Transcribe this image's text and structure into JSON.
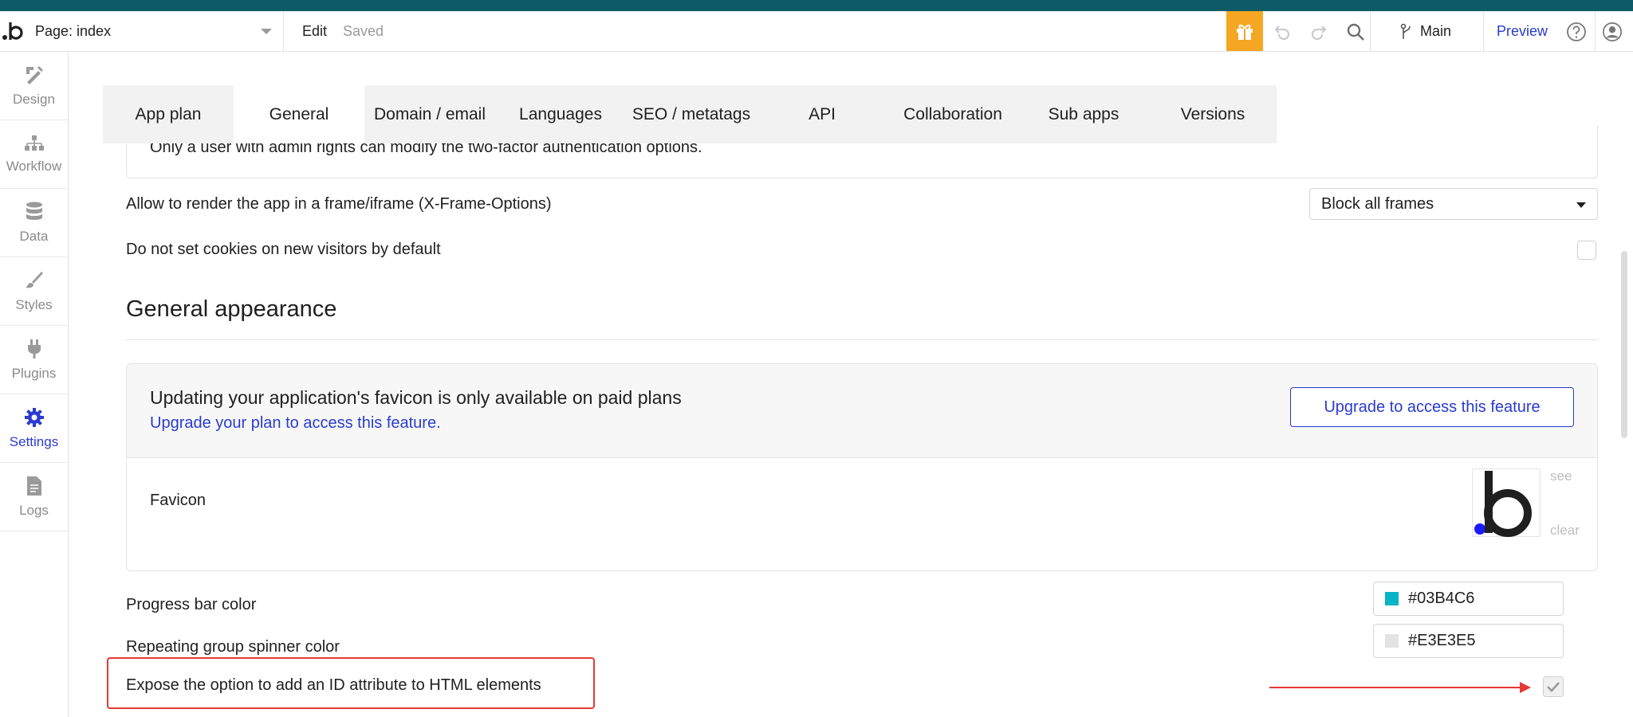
{
  "topbar": {
    "page_label": "Page: index",
    "edit_label": "Edit",
    "saved_label": "Saved",
    "branch_label": "Main",
    "preview_label": "Preview"
  },
  "sidebar": {
    "items": [
      {
        "label": "Design",
        "icon": "design-icon"
      },
      {
        "label": "Workflow",
        "icon": "workflow-icon"
      },
      {
        "label": "Data",
        "icon": "database-icon"
      },
      {
        "label": "Styles",
        "icon": "brush-icon"
      },
      {
        "label": "Plugins",
        "icon": "plug-icon"
      },
      {
        "label": "Settings",
        "icon": "gear-icon",
        "active": true
      },
      {
        "label": "Logs",
        "icon": "document-icon"
      }
    ]
  },
  "tabs": [
    {
      "label": "App plan"
    },
    {
      "label": "General",
      "active": true
    },
    {
      "label": "Domain / email"
    },
    {
      "label": "Languages"
    },
    {
      "label": "SEO / metatags"
    },
    {
      "label": "API"
    },
    {
      "label": "Collaboration"
    },
    {
      "label": "Sub apps"
    },
    {
      "label": "Versions"
    }
  ],
  "settings": {
    "two_factor_note": "Only a user with admin rights can modify the two-factor authentication options.",
    "frame_label": "Allow to render the app in a frame/iframe (X-Frame-Options)",
    "frame_value": "Block all frames",
    "cookies_label": "Do not set cookies on new visitors by default",
    "cookies_checked": false
  },
  "appearance": {
    "section_title": "General appearance",
    "favicon_notice_title": "Updating your application's favicon is only available on paid plans",
    "favicon_notice_link": "Upgrade your plan to access this feature.",
    "upgrade_button": "Upgrade to access this feature",
    "favicon_label": "Favicon",
    "favicon_see": "see",
    "favicon_clear": "clear",
    "progress_label": "Progress bar color",
    "progress_color": "#03B4C6",
    "spinner_label": "Repeating group spinner color",
    "spinner_color": "#E3E3E5",
    "expose_id_label": "Expose the option to add an ID attribute to HTML elements",
    "expose_id_checked": true
  },
  "colors": {
    "accent": "#2a3bd0",
    "topstrip": "#0e5b67",
    "gift": "#f5a623",
    "annotation": "#e53935"
  }
}
